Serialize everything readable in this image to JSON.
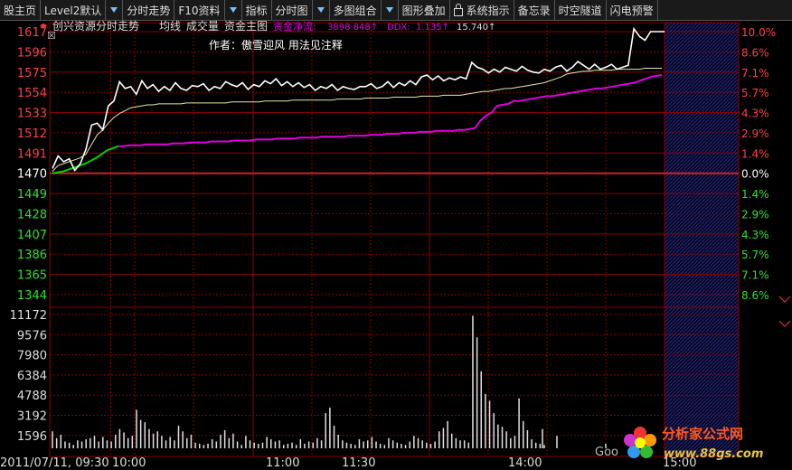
{
  "toolbar": {
    "items": [
      {
        "label": "股主页",
        "drop": false
      },
      {
        "label": "Level2默认",
        "drop": true
      },
      {
        "label": "分时走势",
        "drop": false
      },
      {
        "label": "F10资料",
        "drop": true
      },
      {
        "label": "指标",
        "drop": false
      },
      {
        "label": "分时图",
        "drop": true
      },
      {
        "label": "多图组合",
        "drop": true
      },
      {
        "label": "图形叠加",
        "drop": false
      },
      {
        "label": "系统指示",
        "drop": false,
        "lock": true
      },
      {
        "label": "备忘录",
        "drop": false
      },
      {
        "label": "时空隧道",
        "drop": false
      },
      {
        "label": "闪电预警",
        "drop": false
      }
    ]
  },
  "header": {
    "stock_title": "创兴资源分时走势",
    "tabs": [
      "均线",
      "成交量",
      "资金主图"
    ],
    "flow_label": "资金净流:",
    "flow_value": "3898.848↑",
    "ddx_label": "DDX:",
    "ddx_value": "1.135↑",
    "extra_value": "15.740↑",
    "author_note": "作者：傲雪迎风  用法见注释"
  },
  "colors": {
    "price_line": "#ffffff",
    "avg_line": "#e8e8a0",
    "capital_line": "#e000e0",
    "capital_start": "#00d000",
    "grid": "#8a0000",
    "base_line": "#d02020",
    "up": "#ff4040",
    "down": "#30e030",
    "volume": "#e0e0e0"
  },
  "chart_data": {
    "type": "line",
    "pre_close": 1470,
    "price_axis": {
      "left_labels": [
        "1617",
        "1596",
        "1575",
        "1554",
        "1533",
        "1512",
        "1491",
        "1470",
        "1449",
        "1428",
        "1407",
        "1386",
        "1365",
        "1344"
      ],
      "right_labels": [
        "10.0%",
        "8.6%",
        "7.1%",
        "5.7%",
        "4.3%",
        "2.9%",
        "1.4%",
        "0.0%",
        "1.4%",
        "2.9%",
        "4.3%",
        "5.7%",
        "7.1%",
        "8.6%"
      ],
      "ylim": [
        1344,
        1617
      ]
    },
    "volume_axis": {
      "labels": [
        "11172",
        "9576",
        "7980",
        "6384",
        "4788",
        "3192",
        "1596"
      ],
      "ylim": [
        0,
        12768
      ]
    },
    "time_labels": [
      "2011/07/11, 09:30",
      "10:00",
      "11:00",
      "11:30",
      "14:00",
      "15:00"
    ],
    "price_series": [
      1475,
      1488,
      1482,
      1485,
      1473,
      1480,
      1495,
      1520,
      1522,
      1515,
      1540,
      1545,
      1565,
      1558,
      1560,
      1552,
      1566,
      1558,
      1562,
      1555,
      1560,
      1556,
      1564,
      1558,
      1556,
      1561,
      1560,
      1563,
      1556,
      1560,
      1558,
      1565,
      1562,
      1560,
      1564,
      1557,
      1562,
      1560,
      1566,
      1563,
      1568,
      1561,
      1565,
      1560,
      1564,
      1559,
      1562,
      1556,
      1560,
      1558,
      1562,
      1556,
      1560,
      1558,
      1557,
      1560,
      1560,
      1563,
      1558,
      1560,
      1565,
      1559,
      1564,
      1561,
      1566,
      1562,
      1570,
      1572,
      1567,
      1571,
      1566,
      1569,
      1567,
      1570,
      1568,
      1585,
      1580,
      1578,
      1574,
      1578,
      1575,
      1580,
      1578,
      1576,
      1581,
      1577,
      1575,
      1574,
      1578,
      1576,
      1580,
      1582,
      1576,
      1580,
      1586,
      1582,
      1578,
      1583,
      1578,
      1580,
      1583,
      1578,
      1580,
      1582,
      1620,
      1612,
      1608,
      1617,
      1617,
      1617
    ],
    "avg_series": [
      1472,
      1478,
      1480,
      1482,
      1484,
      1486,
      1490,
      1500,
      1510,
      1515,
      1522,
      1528,
      1532,
      1535,
      1538,
      1539,
      1540,
      1541,
      1541,
      1542,
      1542,
      1542,
      1542,
      1542,
      1543,
      1543,
      1543,
      1543,
      1543,
      1543,
      1543,
      1543,
      1544,
      1544,
      1544,
      1544,
      1544,
      1544,
      1545,
      1545,
      1545,
      1545,
      1545,
      1546,
      1546,
      1546,
      1546,
      1546,
      1546,
      1546,
      1546,
      1547,
      1547,
      1547,
      1547,
      1547,
      1548,
      1548,
      1548,
      1548,
      1548,
      1549,
      1549,
      1549,
      1549,
      1549,
      1550,
      1550,
      1550,
      1550,
      1551,
      1551,
      1551,
      1551,
      1552,
      1553,
      1554,
      1555,
      1555,
      1556,
      1557,
      1558,
      1558,
      1559,
      1560,
      1561,
      1562,
      1563,
      1564,
      1566,
      1568,
      1570,
      1573,
      1574,
      1575,
      1576,
      1576,
      1577,
      1577,
      1577,
      1577,
      1578,
      1578,
      1578,
      1578,
      1578,
      1579,
      1579,
      1579,
      1579
    ],
    "capital_series": [
      1470,
      1471,
      1472,
      1474,
      1476,
      1478,
      1480,
      1483,
      1486,
      1490,
      1494,
      1496,
      1498,
      1498,
      1499,
      1499,
      1499,
      1500,
      1500,
      1500,
      1500,
      1500,
      1501,
      1501,
      1501,
      1502,
      1502,
      1502,
      1502,
      1503,
      1503,
      1503,
      1503,
      1504,
      1504,
      1504,
      1504,
      1505,
      1505,
      1505,
      1505,
      1506,
      1506,
      1506,
      1506,
      1507,
      1507,
      1507,
      1507,
      1508,
      1508,
      1508,
      1508,
      1508,
      1509,
      1509,
      1509,
      1509,
      1510,
      1510,
      1510,
      1511,
      1511,
      1511,
      1512,
      1512,
      1512,
      1513,
      1513,
      1513,
      1514,
      1514,
      1514,
      1514,
      1515,
      1515,
      1516,
      1517,
      1525,
      1530,
      1533,
      1540,
      1541,
      1542,
      1545,
      1545,
      1546,
      1547,
      1548,
      1549,
      1550,
      1550,
      1551,
      1552,
      1553,
      1554,
      1555,
      1556,
      1557,
      1558,
      1558,
      1559,
      1560,
      1561,
      1562,
      1563,
      1564,
      1566,
      1568,
      1570,
      1571,
      1572
    ],
    "volume_series": [
      1500,
      900,
      1200,
      600,
      500,
      300,
      700,
      600,
      800,
      900,
      1100,
      600,
      1000,
      700,
      600,
      1200,
      1700,
      1400,
      900,
      1100,
      3400,
      2500,
      2300,
      1700,
      1300,
      1500,
      1100,
      700,
      1000,
      700,
      2000,
      1500,
      900,
      1200,
      500,
      400,
      300,
      400,
      800,
      600,
      1200,
      1600,
      900,
      1300,
      600,
      300,
      1100,
      700,
      500,
      400,
      500,
      1000,
      800,
      600,
      700,
      300,
      400,
      500,
      300,
      800,
      400,
      600,
      500,
      900,
      700,
      3100,
      3600,
      2000,
      1200,
      700,
      500,
      400,
      300,
      800,
      600,
      700,
      1000,
      600,
      400,
      300,
      900,
      700,
      500,
      400,
      300,
      600,
      1100,
      900,
      700,
      500,
      400,
      600,
      1500,
      1800,
      2400,
      1300,
      900,
      700,
      700,
      500,
      11700,
      9800,
      6800,
      4800,
      4200,
      3100,
      2100,
      1900,
      1500,
      900,
      1100,
      4400,
      2400,
      1600,
      800,
      500,
      400,
      300
    ],
    "late_volume": [
      1700,
      1100,
      400
    ],
    "grid": true
  },
  "watermark": {
    "title": "分析家公式网",
    "url": "www.88gs.com",
    "goo": "Goo"
  }
}
